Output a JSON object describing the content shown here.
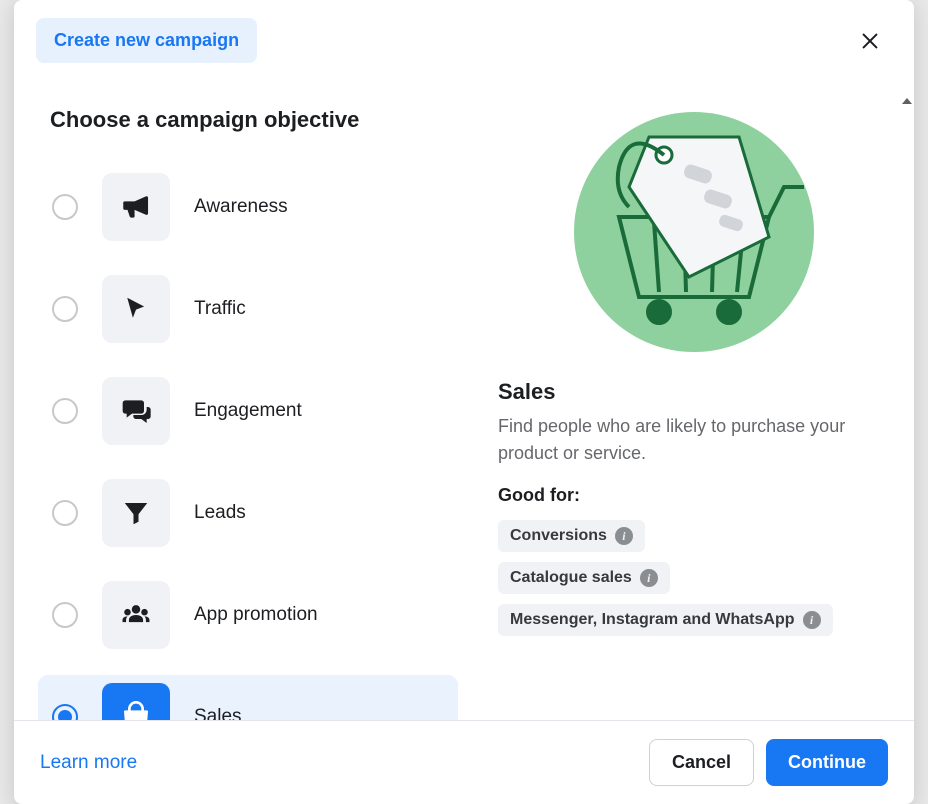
{
  "header": {
    "tab_label": "Create new campaign"
  },
  "section_title": "Choose a campaign objective",
  "objectives": [
    {
      "label": "Awareness",
      "icon": "megaphone",
      "selected": false
    },
    {
      "label": "Traffic",
      "icon": "cursor",
      "selected": false
    },
    {
      "label": "Engagement",
      "icon": "comments",
      "selected": false
    },
    {
      "label": "Leads",
      "icon": "funnel",
      "selected": false
    },
    {
      "label": "App promotion",
      "icon": "people",
      "selected": false
    },
    {
      "label": "Sales",
      "icon": "shopping-bag",
      "selected": true
    }
  ],
  "detail": {
    "title": "Sales",
    "description": "Find people who are likely to purchase your product or service.",
    "good_for_label": "Good for:",
    "tags": [
      "Conversions",
      "Catalogue sales",
      "Messenger, Instagram and WhatsApp"
    ]
  },
  "footer": {
    "learn_more": "Learn more",
    "cancel": "Cancel",
    "continue": "Continue"
  }
}
